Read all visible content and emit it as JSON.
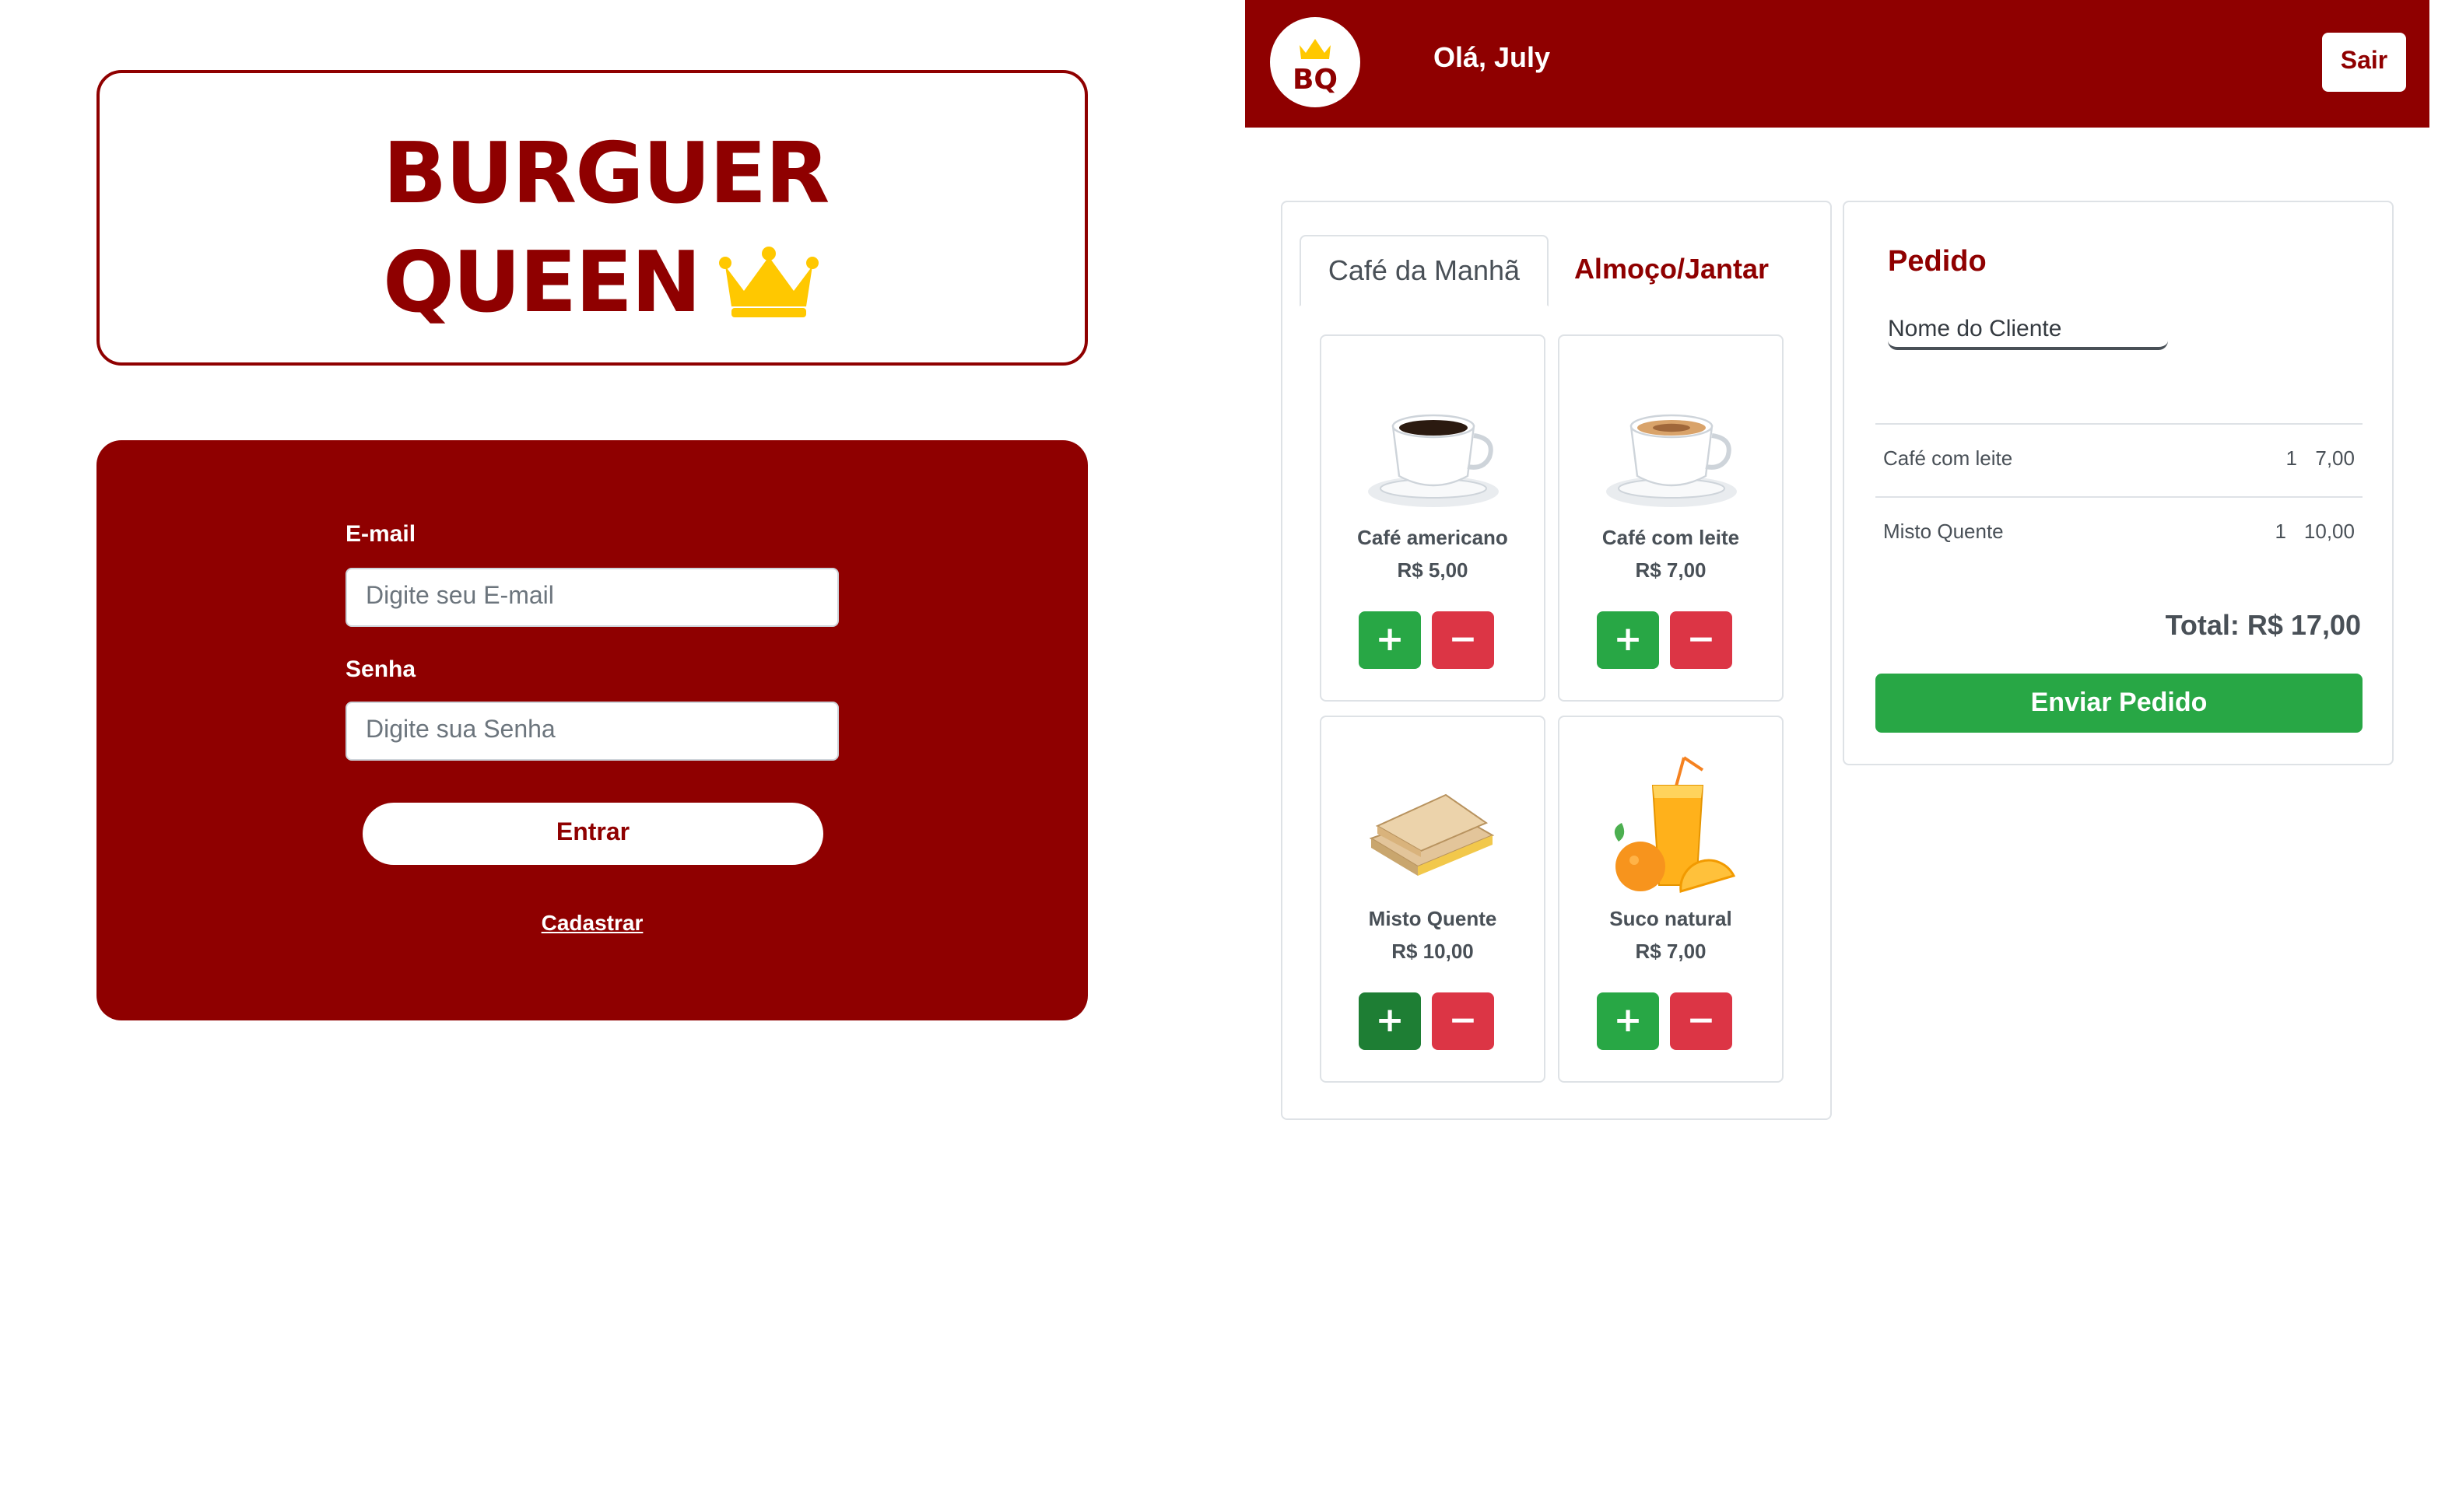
{
  "login": {
    "brand_line1": "BURGUER",
    "brand_line2": "QUEEN",
    "email_label": "E-mail",
    "email_placeholder": "Digite seu E-mail",
    "password_label": "Senha",
    "password_placeholder": "Digite sua Senha",
    "submit_label": "Entrar",
    "register_link": "Cadastrar"
  },
  "header": {
    "logo_text": "BQ",
    "greeting": "Olá, July",
    "logout_label": "Sair"
  },
  "menu": {
    "tabs": [
      {
        "label": "Café da Manhã",
        "active": true
      },
      {
        "label": "Almoço/Jantar",
        "active": false
      }
    ],
    "products": [
      {
        "name": "Café americano",
        "price": "R$ 5,00",
        "icon": "coffee-cup-icon"
      },
      {
        "name": "Café com leite",
        "price": "R$ 7,00",
        "icon": "cappuccino-icon"
      },
      {
        "name": "Misto Quente",
        "price": "R$ 10,00",
        "icon": "sandwich-icon"
      },
      {
        "name": "Suco natural",
        "price": "R$ 7,00",
        "icon": "orange-juice-icon"
      }
    ],
    "add_symbol": "+",
    "remove_symbol": "−"
  },
  "order": {
    "title": "Pedido",
    "client_placeholder": "Nome do Cliente",
    "items": [
      {
        "name": "Café com leite",
        "qty": "1",
        "price": "7,00"
      },
      {
        "name": "Misto Quente",
        "qty": "1",
        "price": "10,00"
      }
    ],
    "total": "Total: R$ 17,00",
    "submit_label": "Enviar Pedido"
  },
  "colors": {
    "brand": "#8f0000",
    "success": "#28a745",
    "danger": "#dc3545",
    "crown": "#ffc800"
  }
}
